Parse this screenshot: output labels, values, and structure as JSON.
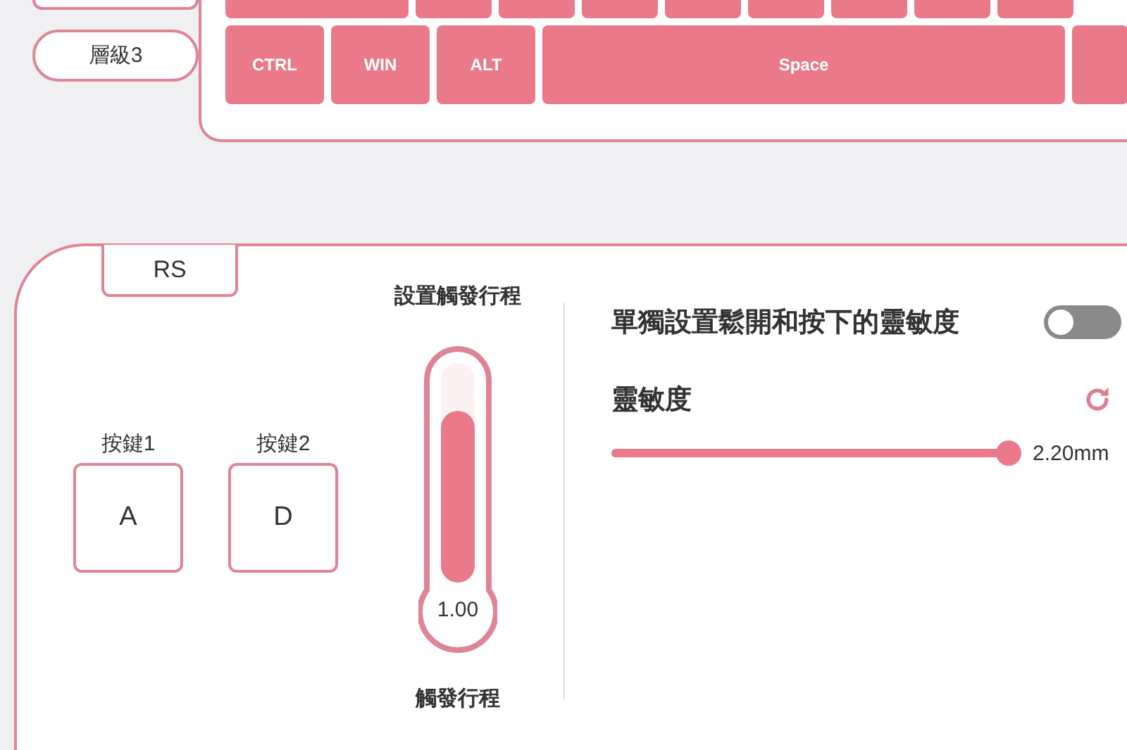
{
  "layers": [
    {
      "label": "層級3"
    }
  ],
  "keyboard": {
    "bottom_row": [
      {
        "label": "CTRL",
        "kind": "normal"
      },
      {
        "label": "WIN",
        "kind": "normal"
      },
      {
        "label": "ALT",
        "kind": "normal"
      },
      {
        "label": "Space",
        "kind": "wide"
      }
    ]
  },
  "key_binding": {
    "tab": "RS",
    "keys": [
      {
        "label": "按鍵1",
        "value": "A"
      },
      {
        "label": "按鍵2",
        "value": "D"
      }
    ]
  },
  "trigger": {
    "title": "設置觸發行程",
    "level": 0.78,
    "reading": "1.00",
    "caption": "觸發行程"
  },
  "sensitivity": {
    "separate_toggle": {
      "label": "單獨設置鬆開和按下的靈敏度",
      "on": false
    },
    "title": "靈敏度",
    "slider": {
      "level": 1,
      "reading": "2.20mm"
    }
  }
}
